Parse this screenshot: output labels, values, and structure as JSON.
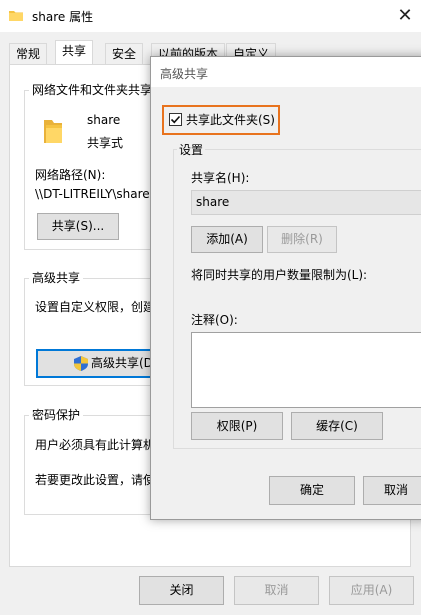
{
  "window": {
    "title": "share 属性",
    "close_glyph": "✕"
  },
  "tabs": [
    {
      "label": "常规"
    },
    {
      "label": "共享",
      "active": true
    },
    {
      "label": "安全"
    },
    {
      "label": "以前的版本"
    },
    {
      "label": "自定义"
    }
  ],
  "network_share": {
    "group_label": "网络文件和文件夹共享",
    "folder_name": "share",
    "share_state": "共享式",
    "path_label": "网络路径(N):",
    "path_value": "\\\\DT-LITREILY\\share",
    "share_button": "共享(S)..."
  },
  "advanced_section": {
    "group_label": "高级共享",
    "description": "设置自定义权限，创建",
    "button": "高级共享(D"
  },
  "password_section": {
    "group_label": "密码保护",
    "line1": "用户必须具有此计算机",
    "line2": "若要更改此设置，请使"
  },
  "footer": {
    "ok": "关闭",
    "cancel": "取消",
    "apply": "应用(A)"
  },
  "dialog": {
    "title": "高级共享",
    "share_checkbox": "共享此文件夹(S)",
    "share_checked": true,
    "settings_label": "设置",
    "share_name_label": "共享名(H):",
    "share_name_value": "share",
    "add_button": "添加(A)",
    "remove_button": "删除(R)",
    "limit_label": "将同时共享的用户数量限制为(L):",
    "comment_label": "注释(O):",
    "permissions_button": "权限(P)",
    "caching_button": "缓存(C)",
    "ok_button": "确定",
    "cancel_button": "取消"
  },
  "colors": {
    "highlight_border": "#e8731e",
    "focus_border": "#0078d7",
    "folder_yellow": "#f5c342"
  }
}
